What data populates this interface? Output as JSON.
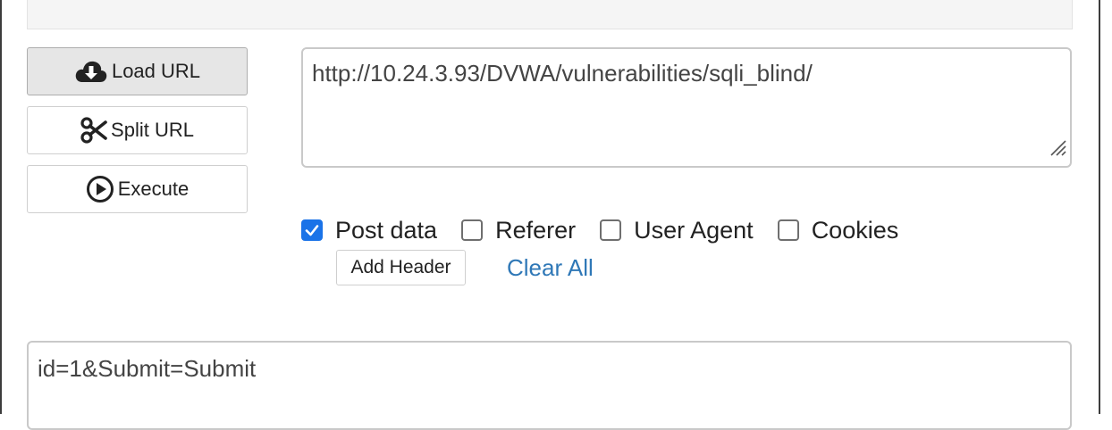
{
  "toolbar": {
    "load_url_label": "Load URL",
    "split_url_label": "Split URL",
    "execute_label": "Execute"
  },
  "url_field": {
    "value": "http://10.24.3.93/DVWA/vulnerabilities/sqli_blind/"
  },
  "options": {
    "post_data": {
      "label": "Post data",
      "checked": true
    },
    "referer": {
      "label": "Referer",
      "checked": false
    },
    "user_agent": {
      "label": "User Agent",
      "checked": false
    },
    "cookies": {
      "label": "Cookies",
      "checked": false
    },
    "add_header_label": "Add Header",
    "clear_all_label": "Clear All"
  },
  "post_field": {
    "value": "id=1&Submit=Submit"
  },
  "colors": {
    "accent": "#1a73e8",
    "link": "#2f78b7"
  },
  "icons": {
    "load": "cloud-download-icon",
    "split": "scissors-icon",
    "execute": "play-circle-icon"
  }
}
